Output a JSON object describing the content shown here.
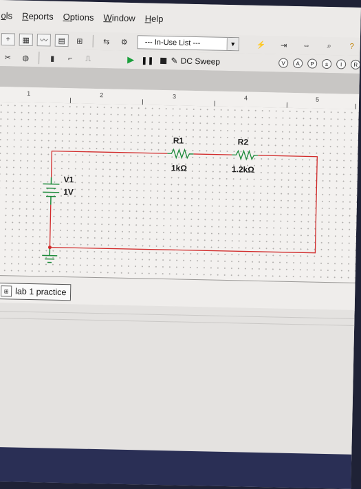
{
  "menu": [
    "ols",
    "Reports",
    "Options",
    "Window",
    "Help"
  ],
  "toolbar": {
    "in_use_list": "--- In-Use List ---",
    "dc_sweep": "DC Sweep"
  },
  "ruler": [
    "1",
    "2",
    "3",
    "4",
    "5"
  ],
  "components": {
    "r1": {
      "name": "R1",
      "value": "1kΩ"
    },
    "r2": {
      "name": "R2",
      "value": "1.2kΩ"
    },
    "v1": {
      "name": "V1",
      "value": "1V"
    }
  },
  "tab": {
    "label": "lab 1 practice"
  },
  "colors": {
    "wire": "#d12a2a",
    "component": "#1c8a3a",
    "taskbar": "#2a2f55"
  }
}
